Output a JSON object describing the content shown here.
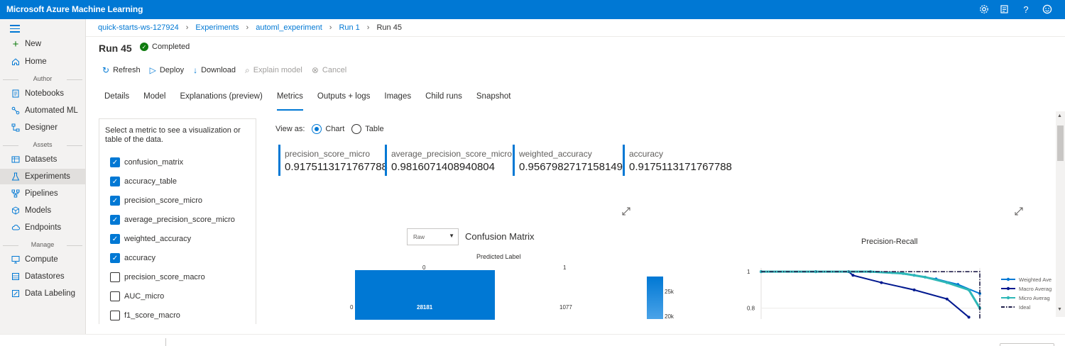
{
  "app": {
    "title": "Microsoft Azure Machine Learning",
    "header_icons": [
      "gear-icon",
      "feedback-list-icon",
      "help-icon",
      "smiley-icon"
    ]
  },
  "sidebar": {
    "items_top": [
      {
        "label": "New",
        "icon": "plus-icon"
      },
      {
        "label": "Home",
        "icon": "home-icon"
      }
    ],
    "sections": {
      "author": "Author",
      "assets": "Assets",
      "manage": "Manage"
    },
    "author_items": [
      {
        "label": "Notebooks",
        "icon": "notebook-icon"
      },
      {
        "label": "Automated ML",
        "icon": "automl-icon"
      },
      {
        "label": "Designer",
        "icon": "designer-icon"
      }
    ],
    "asset_items": [
      {
        "label": "Datasets",
        "icon": "datasets-icon"
      },
      {
        "label": "Experiments",
        "icon": "flask-icon"
      },
      {
        "label": "Pipelines",
        "icon": "pipeline-icon"
      },
      {
        "label": "Models",
        "icon": "cube-icon"
      },
      {
        "label": "Endpoints",
        "icon": "cloud-icon"
      }
    ],
    "manage_items": [
      {
        "label": "Compute",
        "icon": "monitor-icon"
      },
      {
        "label": "Datastores",
        "icon": "database-icon"
      },
      {
        "label": "Data Labeling",
        "icon": "label-icon"
      }
    ]
  },
  "breadcrumb": [
    "quick-starts-ws-127924",
    "Experiments",
    "automl_experiment",
    "Run 1",
    "Run 45"
  ],
  "run": {
    "title": "Run 45",
    "status": "Completed"
  },
  "toolbar": {
    "refresh": "Refresh",
    "deploy": "Deploy",
    "download": "Download",
    "explain": "Explain model",
    "cancel": "Cancel"
  },
  "tabs": [
    "Details",
    "Model",
    "Explanations (preview)",
    "Metrics",
    "Outputs + logs",
    "Images",
    "Child runs",
    "Snapshot"
  ],
  "active_tab": "Metrics",
  "metric_panel": {
    "prompt": "Select a metric to see a visualization or table of the data.",
    "metrics": [
      {
        "name": "confusion_matrix",
        "checked": true
      },
      {
        "name": "accuracy_table",
        "checked": true
      },
      {
        "name": "precision_score_micro",
        "checked": true
      },
      {
        "name": "average_precision_score_micro",
        "checked": true
      },
      {
        "name": "weighted_accuracy",
        "checked": true
      },
      {
        "name": "accuracy",
        "checked": true
      },
      {
        "name": "precision_score_macro",
        "checked": false
      },
      {
        "name": "AUC_micro",
        "checked": false
      },
      {
        "name": "f1_score_macro",
        "checked": false
      }
    ]
  },
  "view_as": {
    "label": "View as:",
    "chart": "Chart",
    "table": "Table",
    "selected": "Chart"
  },
  "scores": [
    {
      "name": "precision_score_micro",
      "value": "0.9175113171767788"
    },
    {
      "name": "average_precision_score_micro",
      "value": "0.9816071408940804"
    },
    {
      "name": "weighted_accuracy",
      "value": "0.9567982717158149"
    },
    {
      "name": "accuracy",
      "value": "0.9175113171767788"
    }
  ],
  "confusion_matrix": {
    "select_value": "Raw",
    "title": "Confusion Matrix",
    "axis_label": "Predicted Label",
    "col_labels": [
      "0",
      "1"
    ],
    "row_label": "0",
    "cell_00": "28181",
    "cell_01": "1077",
    "scale_ticks": [
      "25k",
      "20k"
    ]
  },
  "chart_data": {
    "type": "line",
    "title": "Precision-Recall",
    "ylabel": "",
    "xlabel": "",
    "y_ticks": [
      "1",
      "0.8"
    ],
    "ylim": [
      0.74,
      1.02
    ],
    "legend_placement": "right",
    "series": [
      {
        "name": "Weighted Average",
        "color": "#0078d4",
        "x": [
          0,
          0.25,
          0.5,
          0.6,
          0.7,
          0.8,
          0.9,
          1.0
        ],
        "y": [
          1,
          1,
          1,
          0.995,
          0.98,
          0.96,
          0.93,
          0.88
        ]
      },
      {
        "name": "Macro Average",
        "color": "#00188f",
        "x": [
          0,
          0.25,
          0.4,
          0.42,
          0.55,
          0.7,
          0.85,
          0.95
        ],
        "y": [
          1,
          1,
          1,
          0.98,
          0.94,
          0.9,
          0.85,
          0.75
        ]
      },
      {
        "name": "Micro Average",
        "color": "#2db7b7",
        "x": [
          0,
          0.25,
          0.5,
          0.65,
          0.75,
          0.85,
          0.95,
          1.0
        ],
        "y": [
          1,
          1,
          1,
          0.99,
          0.97,
          0.94,
          0.9,
          0.8
        ]
      },
      {
        "name": "Ideal",
        "color": "#201f4a",
        "x": [
          0,
          1.0,
          1.0
        ],
        "y": [
          1,
          1,
          0.74
        ]
      }
    ],
    "legend_labels": [
      "Weighted Ave",
      "Macro Averag",
      "Micro Averag",
      "Ideal"
    ]
  }
}
